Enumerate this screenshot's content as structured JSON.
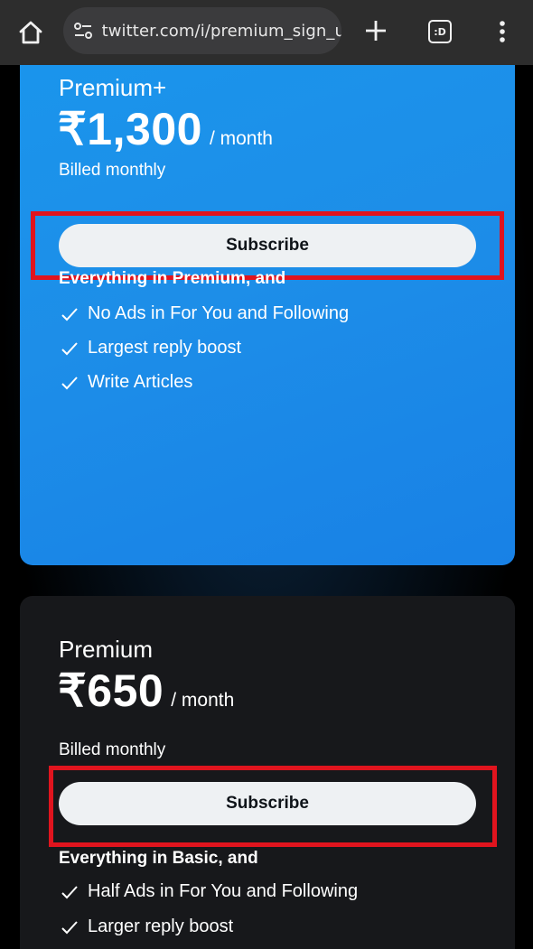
{
  "browser": {
    "url": "twitter.com/i/premium_sign_up",
    "tab_count": ":D"
  },
  "plans": [
    {
      "name": "Premium+",
      "price": "₹1,300",
      "period": "/ month",
      "billing": "Billed monthly",
      "subscribe_label": "Subscribe",
      "features_heading": "Everything in Premium, and",
      "features": [
        "No Ads in For You and Following",
        "Largest reply boost",
        "Write Articles"
      ]
    },
    {
      "name": "Premium",
      "price": "₹650",
      "period": "/ month",
      "billing": "Billed monthly",
      "subscribe_label": "Subscribe",
      "features_heading": "Everything in Basic, and",
      "features": [
        "Half Ads in For You and Following",
        "Larger reply boost"
      ]
    }
  ],
  "colors": {
    "premium_plus_card": "#1d8ee8",
    "premium_card": "#17181b",
    "highlight_box": "#e0141e",
    "button_bg": "#eef1f3"
  }
}
